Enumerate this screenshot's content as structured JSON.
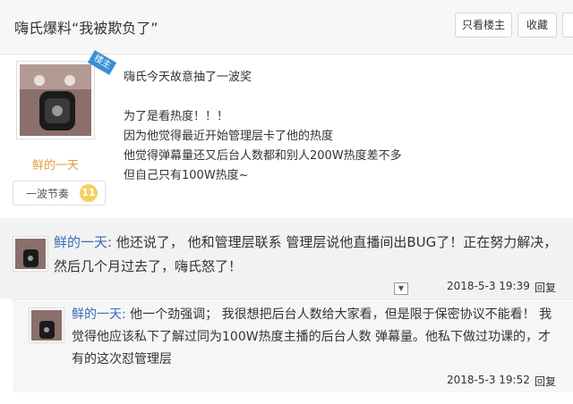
{
  "header": {
    "title": "嗨氏爆料“我被欺负了”",
    "only_op_label": "只看楼主",
    "favorite_label": "收藏"
  },
  "op": {
    "badge": "楼主",
    "username": "鲜的一天",
    "level_label": "一波节奏",
    "level_number": "11",
    "lines": [
      "嗨氏今天故意抽了一波奖",
      "",
      "为了是看热度！！！",
      "因为他觉得最近开始管理层卡了他的热度",
      "他觉得弹幕量还又后台人数都和别人200W热度差不多",
      "但自己只有100W热度~"
    ]
  },
  "reply1": {
    "username": "鲜的一天:",
    "text": "他还说了， 他和管理层联系 管理层说他直播间出BUG了！正在努力解决，然后几个月过去了，嗨氏怒了！",
    "time": "2018-5-3 19:39",
    "reply_label": "回复"
  },
  "reply2": {
    "username": "鲜的一天:",
    "text": "他一个劲强调； 我很想把后台人数给大家看，但是限于保密协议不能看！ 我觉得他应该私下了解过同为100W热度主播的后台人数 弹幕量。他私下做过功课的，才有的这次怼管理层",
    "time": "2018-5-3 19:52",
    "reply_label": "回复"
  },
  "colors": {
    "username": "#3b6bb7",
    "op_name": "#e0a040",
    "badge": "#3b8fd6",
    "level_icon": "#f5d061"
  },
  "icons": {
    "collapse": "chevron-down-icon"
  }
}
